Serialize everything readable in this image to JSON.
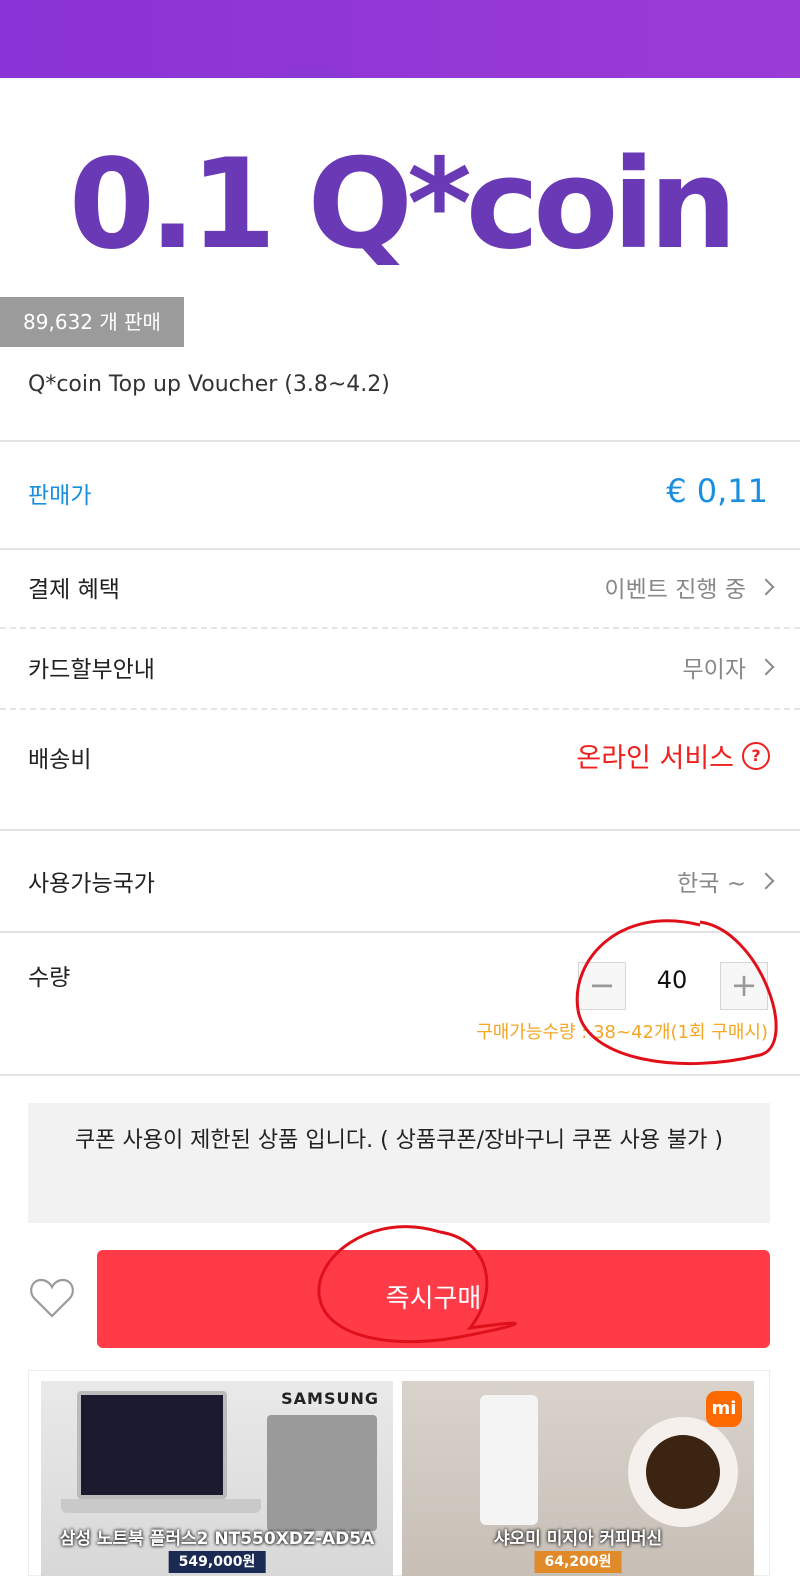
{
  "hero": {
    "logo_text": "0.1 Q*coin",
    "logo_color": "#6a3ab6",
    "sold_count": "89,632 개 판매"
  },
  "product": {
    "title": "Q*coin Top up Voucher (3.8~4.2)"
  },
  "price": {
    "label": "판매가",
    "value": "€ 0,11",
    "color": "#1a8fe0"
  },
  "rows": {
    "payment_benefit": {
      "label": "결제 혜택",
      "value": "이벤트 진행 중"
    },
    "card_installment": {
      "label": "카드할부안내",
      "value": "무이자"
    },
    "shipping": {
      "label": "배송비",
      "value": "온라인 서비스",
      "help_icon": "?"
    },
    "countries": {
      "label": "사용가능국가",
      "value": "한국 ~"
    }
  },
  "quantity": {
    "label": "수량",
    "minus": "−",
    "plus": "+",
    "value": "40",
    "note": "구매가능수량 : 38~42개(1회 구매시)"
  },
  "coupon_notice": "쿠폰 사용이 제한된 상품 입니다. ( 상품쿠폰/장바구니 쿠폰 사용 불가 )",
  "actions": {
    "buy_now": "즉시구매",
    "wishlist_icon": "heart-icon",
    "accent": "#ff3b48"
  },
  "ads": [
    {
      "brand": "SAMSUNG",
      "caption": "삼성 노트북 플러스2 NT550XDZ-AD5A",
      "price": "549,000원"
    },
    {
      "brand": "mi",
      "caption": "샤오미 미지아 커피머신",
      "price": "64,200원"
    }
  ]
}
